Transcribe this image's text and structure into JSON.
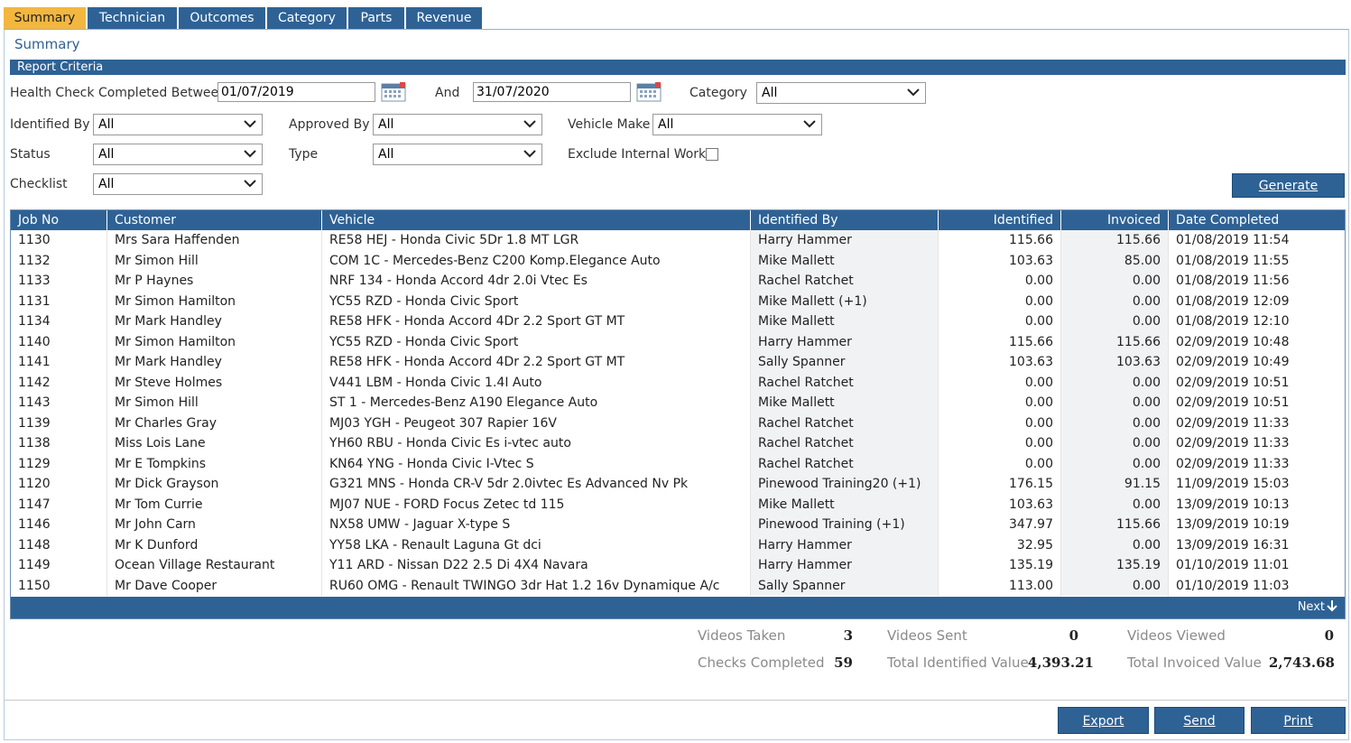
{
  "tabs": [
    {
      "label": "Summary"
    },
    {
      "label": "Technician"
    },
    {
      "label": "Outcomes"
    },
    {
      "label": "Category"
    },
    {
      "label": "Parts"
    },
    {
      "label": "Revenue"
    }
  ],
  "page_title": "Summary",
  "criteria": {
    "title": "Report Criteria",
    "health_check_label": "Health Check Completed Between",
    "date_from": "01/07/2019",
    "and_label": "And",
    "date_to": "31/07/2020",
    "category_label": "Category",
    "category_value": "All",
    "identified_by_label": "Identified By",
    "identified_by_value": "All",
    "approved_by_label": "Approved By",
    "approved_by_value": "All",
    "vehicle_make_label": "Vehicle Make",
    "vehicle_make_value": "All",
    "status_label": "Status",
    "status_value": "All",
    "type_label": "Type",
    "type_value": "All",
    "exclude_label": "Exclude Internal Work",
    "exclude_checked": false,
    "checklist_label": "Checklist",
    "checklist_value": "All",
    "generate_label": "Generate"
  },
  "table": {
    "columns": [
      "Job No",
      "Customer",
      "Vehicle",
      "Identified By",
      "Identified",
      "Invoiced",
      "Date Completed"
    ],
    "rows": [
      [
        "1130",
        "Mrs Sara Haffenden",
        "RE58 HEJ - Honda Civic 5Dr 1.8 MT LGR",
        "Harry Hammer",
        "115.66",
        "115.66",
        "01/08/2019 11:54"
      ],
      [
        "1132",
        "Mr Simon Hill",
        "COM 1C - Mercedes-Benz C200 Komp.Elegance Auto",
        "Mike Mallett",
        "103.63",
        "85.00",
        "01/08/2019 11:55"
      ],
      [
        "1133",
        "Mr P Haynes",
        "NRF 134 - Honda Accord 4dr 2.0i Vtec Es",
        "Rachel Ratchet",
        "0.00",
        "0.00",
        "01/08/2019 11:56"
      ],
      [
        "1131",
        "Mr Simon Hamilton",
        "YC55 RZD - Honda Civic Sport",
        "Mike Mallett (+1)",
        "0.00",
        "0.00",
        "01/08/2019 12:09"
      ],
      [
        "1134",
        "Mr Mark Handley",
        "RE58 HFK - Honda Accord 4Dr 2.2 Sport GT MT",
        "Mike Mallett",
        "0.00",
        "0.00",
        "01/08/2019 12:10"
      ],
      [
        "1140",
        "Mr Simon Hamilton",
        "YC55 RZD - Honda Civic Sport",
        "Harry Hammer",
        "115.66",
        "115.66",
        "02/09/2019 10:48"
      ],
      [
        "1141",
        "Mr Mark Handley",
        "RE58 HFK - Honda Accord 4Dr 2.2 Sport GT MT",
        "Sally Spanner",
        "103.63",
        "103.63",
        "02/09/2019 10:49"
      ],
      [
        "1142",
        "Mr Steve Holmes",
        "V441 LBM - Honda Civic 1.4I Auto",
        "Rachel Ratchet",
        "0.00",
        "0.00",
        "02/09/2019 10:51"
      ],
      [
        "1143",
        "Mr Simon Hill",
        "ST 1 - Mercedes-Benz A190 Elegance Auto",
        "Mike Mallett",
        "0.00",
        "0.00",
        "02/09/2019 10:51"
      ],
      [
        "1139",
        "Mr Charles Gray",
        "MJ03 YGH - Peugeot 307 Rapier 16V",
        "Rachel Ratchet",
        "0.00",
        "0.00",
        "02/09/2019 11:33"
      ],
      [
        "1138",
        "Miss Lois Lane",
        "YH60 RBU - Honda Civic Es i-vtec auto",
        "Rachel Ratchet",
        "0.00",
        "0.00",
        "02/09/2019 11:33"
      ],
      [
        "1129",
        "Mr E Tompkins",
        "KN64 YNG - Honda Civic I-Vtec S",
        "Rachel Ratchet",
        "0.00",
        "0.00",
        "02/09/2019 11:33"
      ],
      [
        "1120",
        "Mr Dick Grayson",
        "G321 MNS - Honda CR-V 5dr 2.0ivtec Es Advanced Nv Pk",
        "Pinewood Training20 (+1)",
        "176.15",
        "91.15",
        "11/09/2019 15:03"
      ],
      [
        "1147",
        "Mr Tom Currie",
        "MJ07 NUE - FORD Focus Zetec td 115",
        "Mike Mallett",
        "103.63",
        "0.00",
        "13/09/2019 10:13"
      ],
      [
        "1146",
        "Mr John Carn",
        "NX58 UMW - Jaguar X-type S",
        "Pinewood Training (+1)",
        "347.97",
        "115.66",
        "13/09/2019 10:19"
      ],
      [
        "1148",
        "Mr K Dunford",
        "YY58 LKA - Renault Laguna Gt dci",
        "Harry Hammer",
        "32.95",
        "0.00",
        "13/09/2019 16:31"
      ],
      [
        "1149",
        "Ocean Village Restaurant",
        "Y11 ARD - Nissan D22 2.5 Di 4X4 Navara",
        "Harry Hammer",
        "135.19",
        "135.19",
        "01/10/2019 11:01"
      ],
      [
        "1150",
        "Mr Dave Cooper",
        "RU60 OMG - Renault TWINGO 3dr Hat 1.2 16v Dynamique A/c",
        "Sally Spanner",
        "113.00",
        "0.00",
        "01/10/2019 11:03"
      ]
    ],
    "next_label": "Next"
  },
  "stats": {
    "videos_taken_label": "Videos Taken",
    "videos_taken": "3",
    "videos_sent_label": "Videos Sent",
    "videos_sent": "0",
    "videos_viewed_label": "Videos Viewed",
    "videos_viewed": "0",
    "checks_completed_label": "Checks Completed",
    "checks_completed": "59",
    "total_identified_label": "Total Identified Value",
    "total_identified": "4,393.21",
    "total_invoiced_label": "Total Invoiced Value",
    "total_invoiced": "2,743.68"
  },
  "actions": {
    "export_label": "Export",
    "send_label": "Send",
    "print_label": "Print"
  },
  "colors": {
    "primary": "#2e6295",
    "active_tab": "#f3b73f",
    "shade": "#f1f2f4"
  }
}
